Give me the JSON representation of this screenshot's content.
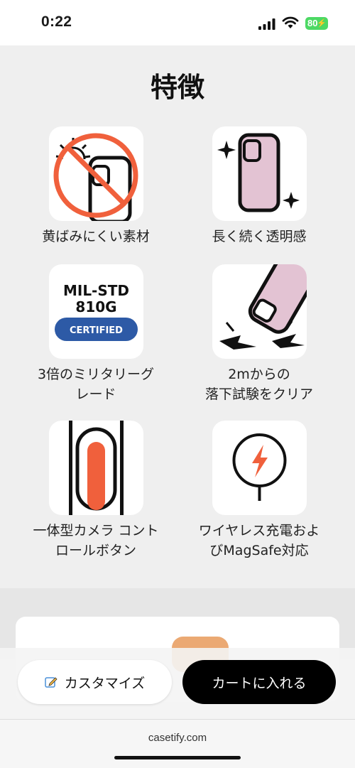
{
  "status_bar": {
    "time": "0:22",
    "battery": "80"
  },
  "page": {
    "title": "特徴"
  },
  "features": [
    {
      "label": "黄ばみにくい素材",
      "icon": "no-sun-yellowing-icon"
    },
    {
      "label": "長く続く透明感",
      "icon": "clear-case-sparkle-icon"
    },
    {
      "label": "3倍のミリタリーグ\nレード",
      "icon": "mil-std-badge-icon",
      "badge_line1": "MIL-STD",
      "badge_line2": "810G",
      "badge_certified": "CERTIFIED"
    },
    {
      "label": "2mからの\n落下試験をクリア",
      "icon": "drop-test-icon"
    },
    {
      "label": "一体型カメラ コント\nロールボタン",
      "icon": "camera-control-button-icon"
    },
    {
      "label": "ワイヤレス充電およ\nびMagSafe対応",
      "icon": "magsafe-charging-icon"
    }
  ],
  "actions": {
    "customize_label": "カスタマイズ",
    "cart_label": "カートに入れる"
  },
  "browser": {
    "url": "casetify.com"
  },
  "colors": {
    "accent_orange": "#f0603c",
    "case_pink": "#e3c3d3",
    "badge_blue": "#2d5aa6",
    "battery_green": "#4cd964"
  }
}
